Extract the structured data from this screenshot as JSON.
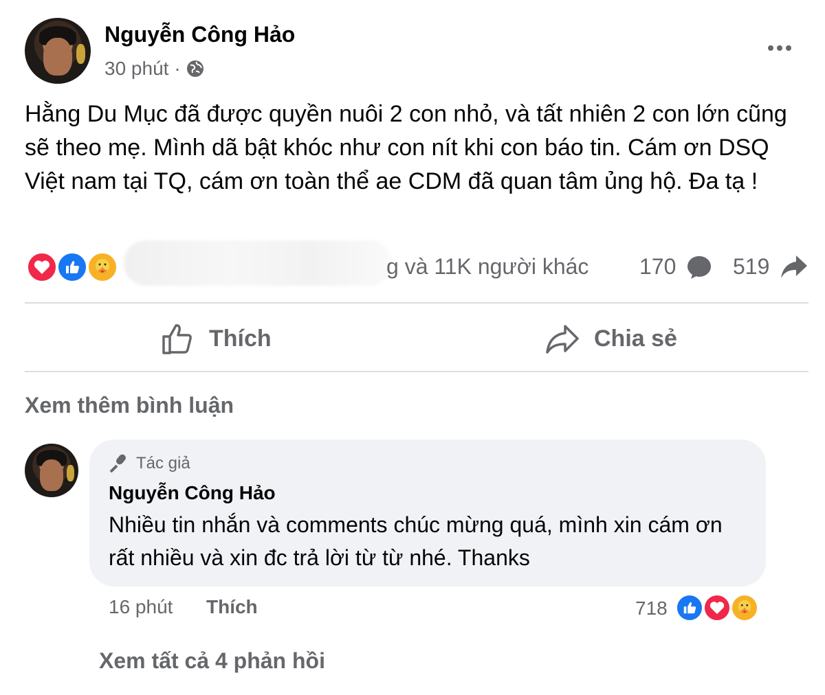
{
  "post": {
    "author": "Nguyễn Công Hảo",
    "time": "30 phút",
    "separator": "·",
    "privacy_icon": "globe-icon",
    "body": "Hằng Du Mục đã được quyền nuôi 2 con nhỏ, và tất nhiên 2 con lớn cũng sẽ theo mẹ. Mình dã bật khóc như con nít khi con báo tin. Cám ơn DSQ Việt nam tại TQ, cám ơn toàn thể ae CDM đã quan tâm ủng hộ. Đa tạ !"
  },
  "reactions": {
    "types": [
      "love",
      "like",
      "care"
    ],
    "summary": "g và 11K người khác",
    "comments": "170",
    "shares": "519"
  },
  "actions": {
    "like_label": "Thích",
    "share_label": "Chia sẻ"
  },
  "comments": {
    "view_more": "Xem thêm bình luận",
    "items": [
      {
        "badge": "Tác giả",
        "author": "Nguyễn Công Hảo",
        "text": "Nhiều tin nhắn và comments chúc mừng quá, mình xin cám ơn rất nhiều và xin đc trả lời từ từ nhé. Thanks",
        "time": "16 phút",
        "like_label": "Thích",
        "reaction_count": "718",
        "reaction_types": [
          "like",
          "love",
          "care"
        ],
        "view_replies": "Xem tất cả 4 phản hồi"
      }
    ]
  },
  "colors": {
    "secondary_text": "#65676b",
    "bubble_bg": "#f0f2f5",
    "like_blue": "#1877f2",
    "love_red": "#f02849",
    "care_yellow": "#f7b125",
    "divider": "#dadde1"
  }
}
